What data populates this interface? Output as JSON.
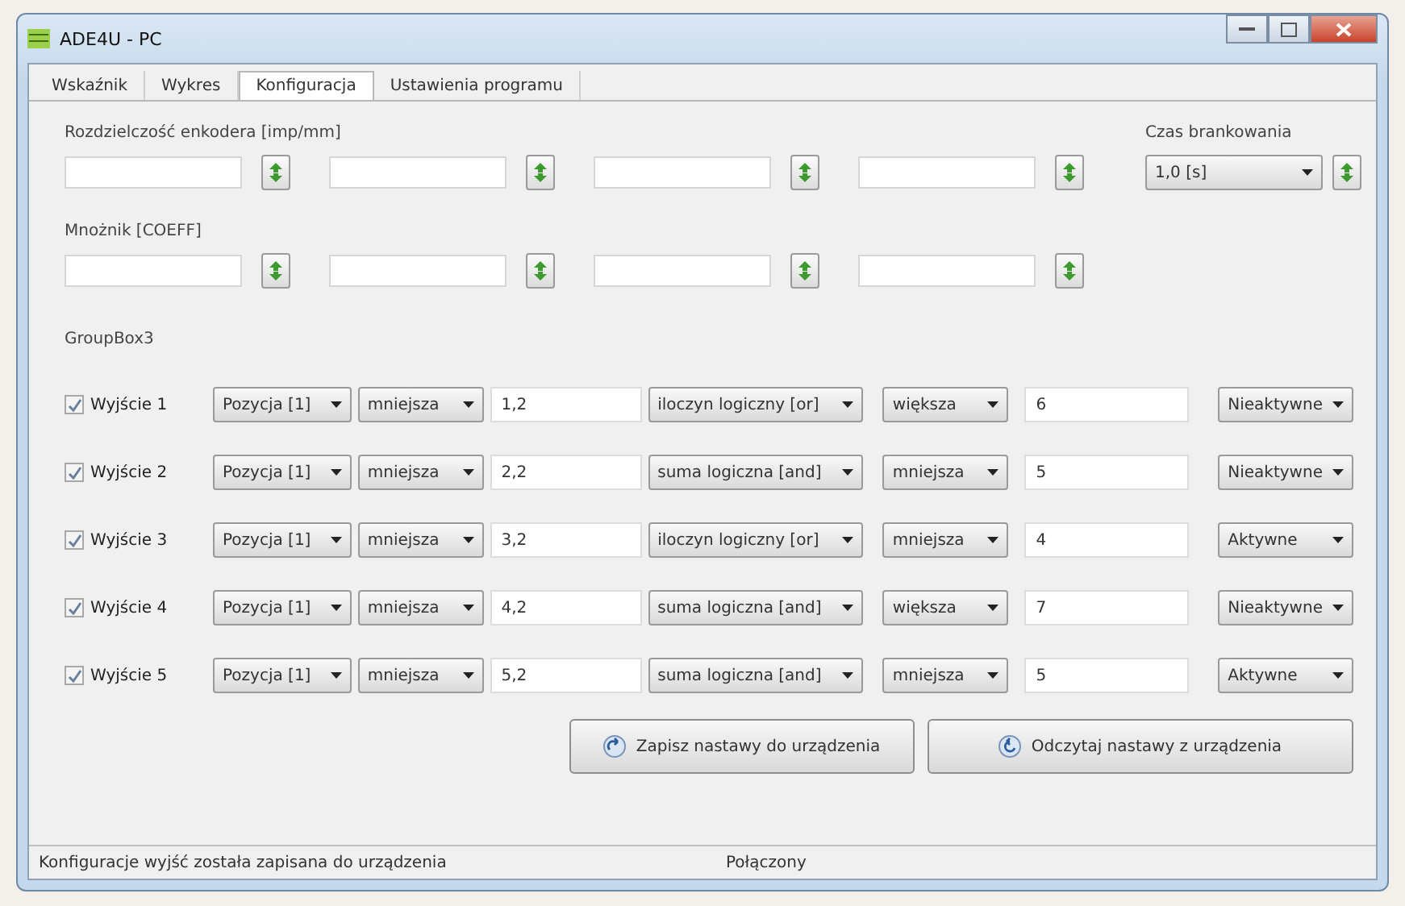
{
  "window": {
    "title": "ADE4U - PC"
  },
  "tabs": [
    {
      "label": "Wskaźnik",
      "selected": false
    },
    {
      "label": "Wykres",
      "selected": false
    },
    {
      "label": "Konfiguracja",
      "selected": true
    },
    {
      "label": "Ustawienia programu",
      "selected": false
    }
  ],
  "encoder_resolution": {
    "label": "Rozdzielczość enkodera [imp/mm]"
  },
  "blanking_time": {
    "label": "Czas brankowania",
    "value": "1,0   [s]"
  },
  "coefficient": {
    "label": "Mnożnik [COEFF]"
  },
  "group": {
    "title": "GroupBox3",
    "outputs": [
      {
        "label": "Wyjście 1",
        "checked": true,
        "source": "Pozycja [1]",
        "compare1": "mniejsza",
        "value1": "1,2",
        "logic": "iloczyn logiczny [or]",
        "compare2": "większa",
        "value2": "6",
        "state": "Nieaktywne"
      },
      {
        "label": "Wyjście 2",
        "checked": true,
        "source": "Pozycja [1]",
        "compare1": "mniejsza",
        "value1": "2,2",
        "logic": "suma logiczna [and]",
        "compare2": "mniejsza",
        "value2": "5",
        "state": "Nieaktywne"
      },
      {
        "label": "Wyjście 3",
        "checked": true,
        "source": "Pozycja [1]",
        "compare1": "mniejsza",
        "value1": "3,2",
        "logic": "iloczyn logiczny [or]",
        "compare2": "mniejsza",
        "value2": "4",
        "state": "Aktywne"
      },
      {
        "label": "Wyjście 4",
        "checked": true,
        "source": "Pozycja [1]",
        "compare1": "mniejsza",
        "value1": "4,2",
        "logic": "suma logiczna [and]",
        "compare2": "większa",
        "value2": "7",
        "state": "Nieaktywne"
      },
      {
        "label": "Wyjście 5",
        "checked": true,
        "source": "Pozycja [1]",
        "compare1": "mniejsza",
        "value1": "5,2",
        "logic": "suma logiczna [and]",
        "compare2": "mniejsza",
        "value2": "5",
        "state": "Aktywne"
      }
    ]
  },
  "buttons": [
    {
      "label": "Zapisz nastawy do urządzenia",
      "kind": "write"
    },
    {
      "label": "Odczytaj nastawy  z urządzenia",
      "kind": "read"
    }
  ],
  "status_bar": [
    "Konfiguracje wyjść została zapisana do urządzenia",
    "Połączony"
  ]
}
